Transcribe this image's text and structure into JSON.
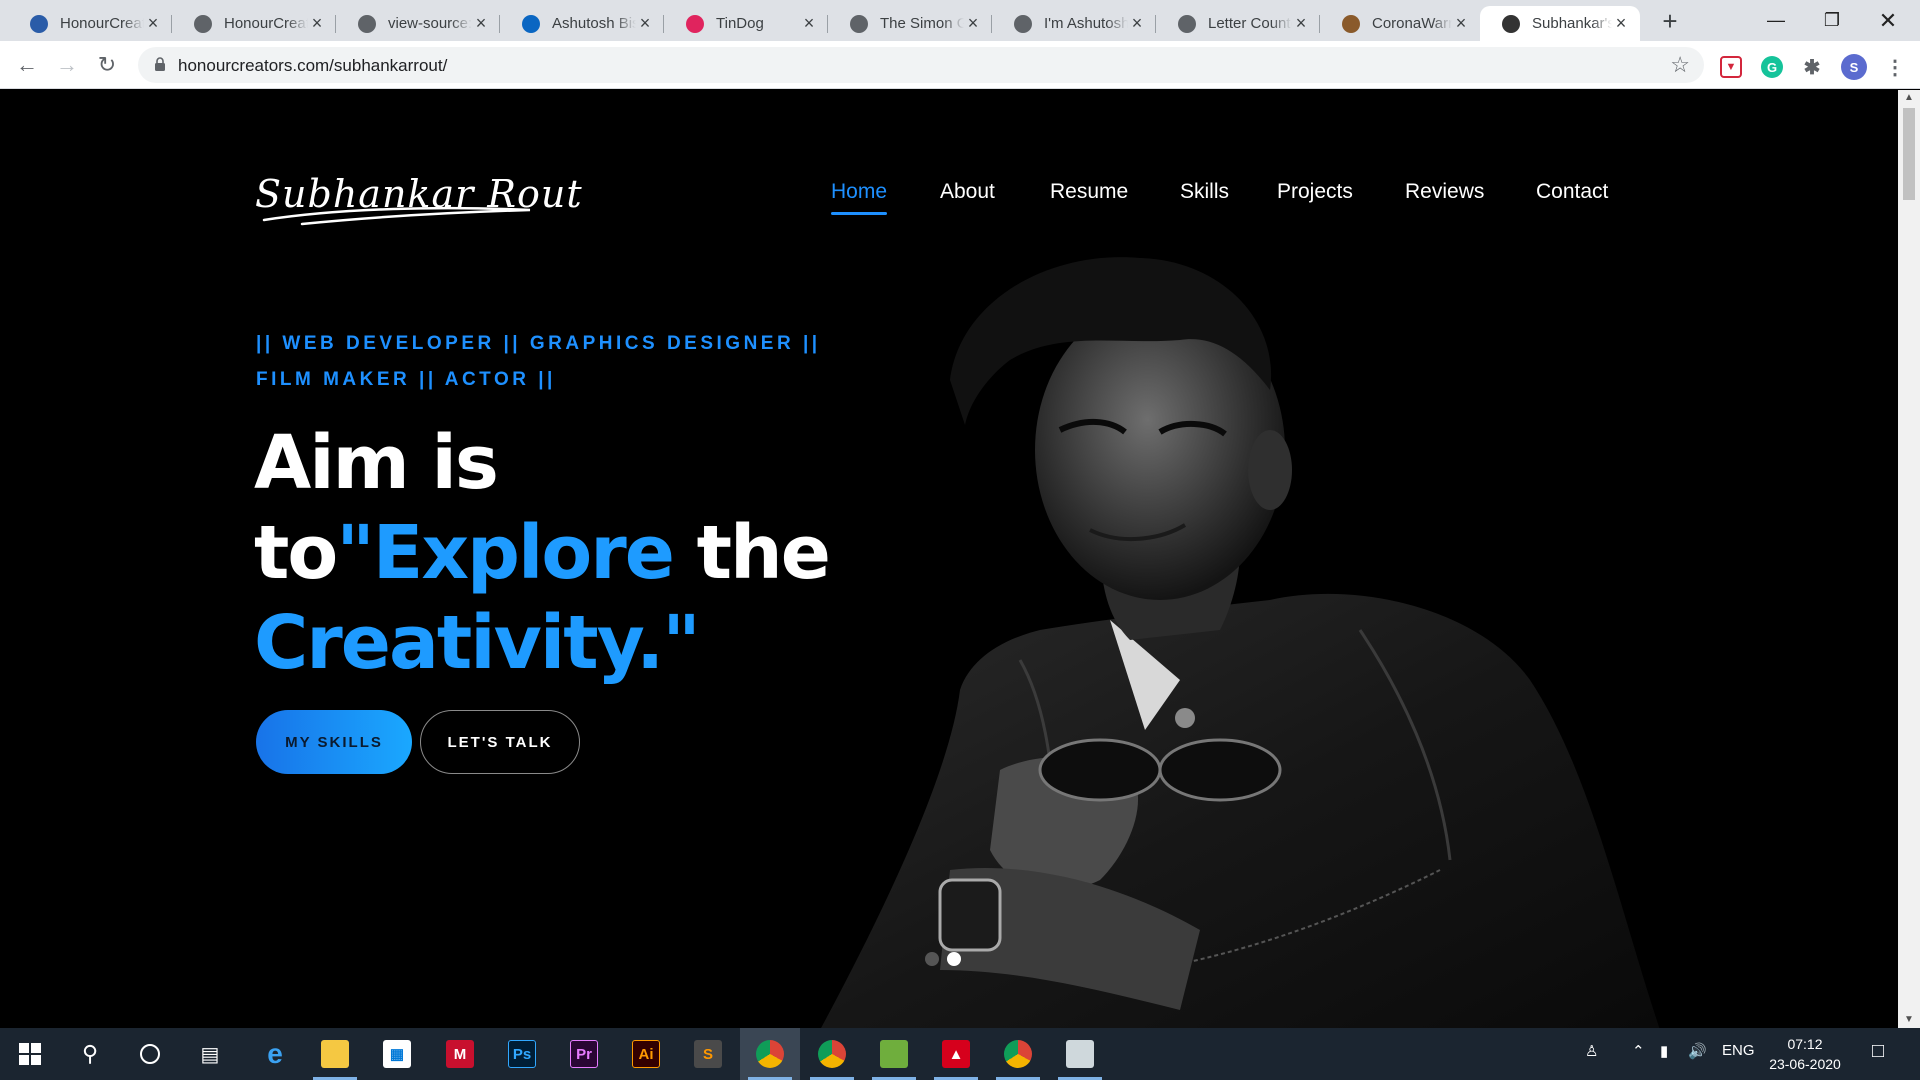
{
  "browser": {
    "tabs": [
      {
        "title": "HonourCreators",
        "favicon": "honourcreators-logo-icon",
        "color": "#2a5ca8"
      },
      {
        "title": "HonourCreators",
        "favicon": "globe-icon",
        "color": "#5f6368"
      },
      {
        "title": "view-source:",
        "favicon": "globe-icon",
        "color": "#5f6368"
      },
      {
        "title": "Ashutosh Biswal",
        "favicon": "linkedin-icon",
        "color": "#0a66c2"
      },
      {
        "title": "TinDog",
        "favicon": "tindog-icon",
        "color": "#e0245e"
      },
      {
        "title": "The Simon Game",
        "favicon": "globe-icon",
        "color": "#5f6368"
      },
      {
        "title": "I'm Ashutosh",
        "favicon": "globe-icon",
        "color": "#5f6368"
      },
      {
        "title": "Letter Counter",
        "favicon": "globe-icon",
        "color": "#5f6368"
      },
      {
        "title": "CoronaWarriors",
        "favicon": "virus-icon",
        "color": "#8a5a2b"
      },
      {
        "title": "Subhankar's",
        "favicon": "person-icon",
        "color": "#333333"
      }
    ],
    "active_tab_index": 9,
    "url": "honourcreators.com/subhankarrout/",
    "profile_initial": "S"
  },
  "site": {
    "logo_text": "Subhankar Rout",
    "nav": [
      "Home",
      "About",
      "Resume",
      "Skills",
      "Projects",
      "Reviews",
      "Contact"
    ],
    "active_nav": "Home",
    "subtitle": "|| WEB DEVELOPER || GRAPHICS DESIGNER || FILM MAKER || ACTOR ||",
    "headline": {
      "line1": "Aim is",
      "line2_prefix": "to",
      "line2_highlight": "\"Explore",
      "line2_suffix": " the",
      "line3": "Creativity.\""
    },
    "buttons": {
      "skills": "MY SKILLS",
      "talk": "LET'S TALK"
    },
    "slider": {
      "count": 2,
      "active": 1
    },
    "accent_color": "#1e90ff"
  },
  "taskbar": {
    "apps": [
      "windows-start-icon",
      "search-icon",
      "cortana-icon",
      "task-view-icon",
      "edge-icon",
      "file-explorer-icon",
      "store-icon",
      "mcafee-icon",
      "photoshop-icon",
      "premiere-icon",
      "illustrator-icon",
      "sublime-icon",
      "chrome-profile-icon",
      "chrome-icon",
      "image-viewer-icon",
      "acrobat-icon",
      "chrome-alt-icon",
      "remote-desktop-icon"
    ],
    "photoshop_label": "Ps",
    "premiere_label": "Pr",
    "illustrator_label": "Ai",
    "language": "ENG",
    "time": "07:12",
    "date": "23-06-2020"
  }
}
